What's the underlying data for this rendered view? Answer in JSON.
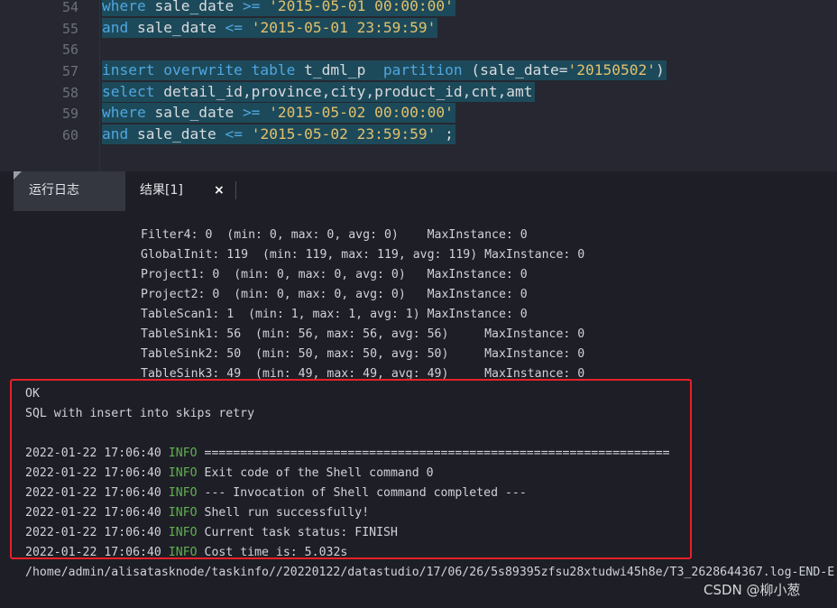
{
  "editor": {
    "lines": [
      {
        "num": "54",
        "text": [
          {
            "t": "where",
            "c": "kw"
          },
          {
            "t": " sale_date ",
            "c": ""
          },
          {
            "t": ">=",
            "c": "op"
          },
          {
            "t": " ",
            "c": ""
          },
          {
            "t": "'2015-05-01 00:00:00'",
            "c": "str"
          }
        ]
      },
      {
        "num": "55",
        "text": [
          {
            "t": "and",
            "c": "kw"
          },
          {
            "t": " sale_date ",
            "c": ""
          },
          {
            "t": "<=",
            "c": "op"
          },
          {
            "t": " ",
            "c": ""
          },
          {
            "t": "'2015-05-01 23:59:59'",
            "c": "str"
          }
        ]
      },
      {
        "num": "56",
        "text": []
      },
      {
        "num": "57",
        "text": [
          {
            "t": "insert overwrite table",
            "c": "kw"
          },
          {
            "t": " t_dml_p  ",
            "c": ""
          },
          {
            "t": "partition",
            "c": "kw"
          },
          {
            "t": " (sale_date=",
            "c": ""
          },
          {
            "t": "'20150502'",
            "c": "str"
          },
          {
            "t": ")",
            "c": ""
          }
        ]
      },
      {
        "num": "58",
        "text": [
          {
            "t": "select",
            "c": "kw"
          },
          {
            "t": " detail_id,province,city,product_id,cnt,amt",
            "c": ""
          }
        ]
      },
      {
        "num": "59",
        "text": [
          {
            "t": "where",
            "c": "kw"
          },
          {
            "t": " sale_date ",
            "c": ""
          },
          {
            "t": ">=",
            "c": "op"
          },
          {
            "t": " ",
            "c": ""
          },
          {
            "t": "'2015-05-02 00:00:00'",
            "c": "str"
          }
        ]
      },
      {
        "num": "60",
        "text": [
          {
            "t": "and",
            "c": "kw"
          },
          {
            "t": " sale_date ",
            "c": ""
          },
          {
            "t": "<=",
            "c": "op"
          },
          {
            "t": " ",
            "c": ""
          },
          {
            "t": "'2015-05-02 23:59:59'",
            "c": "str"
          },
          {
            "t": " ;",
            "c": ""
          }
        ]
      }
    ]
  },
  "tabs": {
    "run_log": "运行日志",
    "result": "结果[1]",
    "close": "×"
  },
  "log": {
    "stats": [
      "Filter4: 0  (min: 0, max: 0, avg: 0)    MaxInstance: 0",
      "GlobalInit: 119  (min: 119, max: 119, avg: 119) MaxInstance: 0",
      "Project1: 0  (min: 0, max: 0, avg: 0)   MaxInstance: 0",
      "Project2: 0  (min: 0, max: 0, avg: 0)   MaxInstance: 0",
      "TableScan1: 1  (min: 1, max: 1, avg: 1) MaxInstance: 0",
      "TableSink1: 56  (min: 56, max: 56, avg: 56)     MaxInstance: 0",
      "TableSink2: 50  (min: 50, max: 50, avg: 50)     MaxInstance: 0",
      "TableSink3: 49  (min: 49, max: 49, avg: 49)     MaxInstance: 0"
    ],
    "ok": "OK",
    "retry": "SQL with insert into skips retry",
    "info_level": "INFO",
    "entries": [
      {
        "ts": "2022-01-22 17:06:40",
        "msg": "================================================================="
      },
      {
        "ts": "2022-01-22 17:06:40",
        "msg": "Exit code of the Shell command 0"
      },
      {
        "ts": "2022-01-22 17:06:40",
        "msg": "--- Invocation of Shell command completed ---"
      },
      {
        "ts": "2022-01-22 17:06:40",
        "msg": "Shell run successfully!"
      },
      {
        "ts": "2022-01-22 17:06:40",
        "msg": "Current task status: FINISH"
      },
      {
        "ts": "2022-01-22 17:06:40",
        "msg": "Cost time is: 5.032s"
      }
    ],
    "path": "/home/admin/alisatasknode/taskinfo//20220122/datastudio/17/06/26/5s89395zfsu28xtudwi45h8e/T3_2628644367.log-END-E"
  },
  "watermark": "CSDN @柳小葱",
  "colors": {
    "info": "#5fb04e",
    "highlight_box": "#e8202a",
    "keyword": "#4fa6e0",
    "string": "#e3c06d"
  }
}
